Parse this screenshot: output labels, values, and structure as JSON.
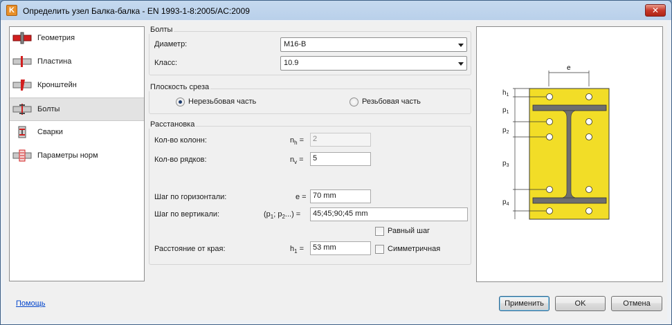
{
  "window": {
    "title": "Определить узел Балка-балка - EN 1993-1-8:2005/AC:2009",
    "app_icon_letter": "K",
    "close_glyph": "✕"
  },
  "sidebar": {
    "items": [
      {
        "label": "Геометрия",
        "icon": "geometry-icon"
      },
      {
        "label": "Пластина",
        "icon": "plate-icon"
      },
      {
        "label": "Кронштейн",
        "icon": "bracket-icon"
      },
      {
        "label": "Болты",
        "icon": "bolts-icon",
        "selected": true
      },
      {
        "label": "Сварки",
        "icon": "welds-icon"
      },
      {
        "label": "Параметры норм",
        "icon": "code-parameters-icon"
      }
    ]
  },
  "bolts": {
    "group_title": "Болты",
    "diameter_label": "Диаметр:",
    "diameter_value": "M16-B",
    "class_label": "Класс:",
    "class_value": "10.9"
  },
  "shear_plane": {
    "group_title": "Плоскость среза",
    "option_unthreaded": "Нерезьбовая часть",
    "option_threaded": "Резьбовая часть",
    "selected": "unthreaded"
  },
  "layout": {
    "group_title": "Расстановка",
    "columns_label": "Кол-во колонн:",
    "columns_symbol": "n",
    "columns_sub": "h",
    "columns_value": "2",
    "rows_label": "Кол-во рядков:",
    "rows_symbol": "n",
    "rows_sub": "v",
    "rows_value": "5",
    "hstep_label": "Шаг по горизонтали:",
    "hstep_symbol": "e =",
    "hstep_value": "70 mm",
    "vstep_label": "Шаг по вертикали:",
    "vstep_symbol_a": "(p",
    "vstep_sub_1": "1",
    "vstep_symbol_b": "; p",
    "vstep_sub_2": "2",
    "vstep_symbol_c": "...) =",
    "vstep_value": "45;45;90;45 mm",
    "equal_step_label": "Равный шаг",
    "edge_label": "Расстояние от края:",
    "edge_symbol": "h",
    "edge_sub": "1",
    "edge_value": "53 mm",
    "symmetric_label": "Симметричная"
  },
  "preview": {
    "label_e": "e",
    "label_h1": "h",
    "label_h1_sub": "1",
    "label_p1": "p",
    "label_p1_sub": "1",
    "label_p2": "p",
    "label_p2_sub": "2",
    "label_p3": "p",
    "label_p3_sub": "3",
    "label_p4": "p",
    "label_p4_sub": "4",
    "plate_color": "#f2dd27",
    "beam_color": "#6e6e6e"
  },
  "footer": {
    "help_link": "Помощь",
    "apply_button": "Применить",
    "ok_button": "OK",
    "cancel_button": "Отмена"
  }
}
